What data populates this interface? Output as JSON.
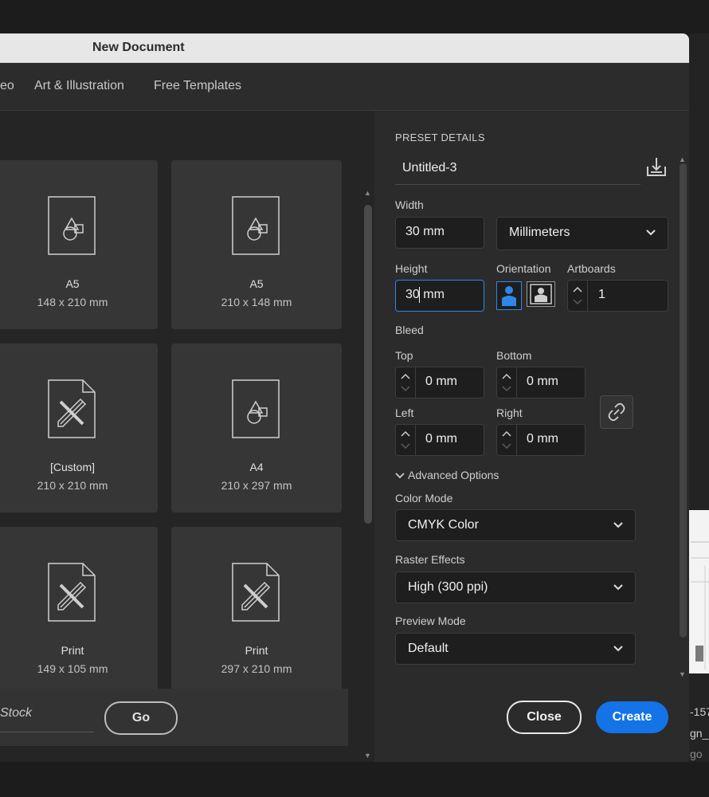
{
  "dialog": {
    "title": "New Document"
  },
  "tabs": [
    {
      "label": "eo"
    },
    {
      "label": "Art & Illustration"
    },
    {
      "label": "Free Templates"
    }
  ],
  "presets": [
    {
      "name": "A5",
      "size": "148 x 210 mm",
      "icon": "shapes-document-icon"
    },
    {
      "name": "A5",
      "size": "210 x 148 mm",
      "icon": "shapes-document-icon"
    },
    {
      "name": "[Custom]",
      "size": "210 x 210 mm",
      "icon": "pencil-ruler-document-icon"
    },
    {
      "name": "A4",
      "size": "210 x 297 mm",
      "icon": "shapes-document-icon"
    },
    {
      "name": "Print",
      "size": "149 x 105 mm",
      "icon": "pencil-ruler-document-icon"
    },
    {
      "name": "Print",
      "size": "297 x 210 mm",
      "icon": "pencil-ruler-document-icon"
    }
  ],
  "footer_left": {
    "search_text": "Stock",
    "go_label": "Go"
  },
  "details": {
    "section_title": "PRESET DETAILS",
    "doc_name": "Untitled-3",
    "width_label": "Width",
    "width_value": "30 mm",
    "units": "Millimeters",
    "height_label": "Height",
    "height_value": "30 mm",
    "orientation_label": "Orientation",
    "artboards_label": "Artboards",
    "artboards_value": "1",
    "bleed_label": "Bleed",
    "top_label": "Top",
    "top_value": "0 mm",
    "bottom_label": "Bottom",
    "bottom_value": "0 mm",
    "left_label": "Left",
    "left_value": "0 mm",
    "right_label": "Right",
    "right_value": "0 mm",
    "advanced_label": "Advanced Options",
    "color_mode_label": "Color Mode",
    "color_mode_value": "CMYK Color",
    "raster_label": "Raster Effects",
    "raster_value": "High (300 ppi)",
    "preview_label": "Preview Mode",
    "preview_value": "Default"
  },
  "buttons": {
    "close": "Close",
    "create": "Create"
  },
  "side_text": [
    "-157",
    "gn_S",
    "go"
  ],
  "colors": {
    "accent": "#1473e6",
    "focus": "#2f86e6",
    "dialog_bg": "#2b2b2b",
    "card_bg": "#363636"
  }
}
